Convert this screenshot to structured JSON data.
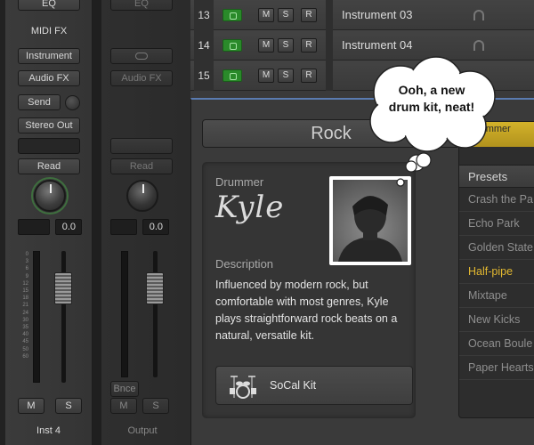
{
  "strip1": {
    "eq": "EQ",
    "midi_fx": "MIDI FX",
    "instrument": "Instrument",
    "audio_fx": "Audio FX",
    "send": "Send",
    "output": "Stereo Out",
    "automation": "Read",
    "volume": "0.0",
    "mute": "M",
    "solo": "S",
    "name": "Inst 4"
  },
  "strip2": {
    "eq": "EQ",
    "audio_fx": "Audio FX",
    "automation": "Read",
    "volume": "0.0",
    "bounce": "Bnce",
    "mute": "M",
    "solo": "S",
    "name": "Output"
  },
  "fader_scale": [
    "0",
    "3",
    "6",
    "9",
    "12",
    "15",
    "18",
    "21",
    "24",
    "30",
    "35",
    "40",
    "45",
    "50",
    "60"
  ],
  "tracks": [
    {
      "number": "13",
      "mute": "M",
      "solo": "S",
      "record": "R",
      "name": "Instrument 03"
    },
    {
      "number": "14",
      "mute": "M",
      "solo": "S",
      "record": "R",
      "name": "Instrument 04"
    },
    {
      "number": "15",
      "mute": "M",
      "solo": "S",
      "record": "R",
      "name": ""
    }
  ],
  "editor": {
    "style": "Rock",
    "drummer_label": "Drummer",
    "drummer_name": "Kyle",
    "description_label": "Description",
    "description": "Influenced by modern rock, but comfortable with most genres, Kyle plays straightforward rock beats on a natural, versatile kit.",
    "kit": "SoCal Kit",
    "tab": "Drummer",
    "presets_label": "Presets",
    "presets": [
      "Crash the Pa",
      "Echo Park",
      "Golden State",
      "Half-pipe",
      "Mixtape",
      "New Kicks",
      "Ocean Boule",
      "Paper Hearts"
    ],
    "selected_preset": "Half-pipe"
  },
  "bubble": {
    "text_line1": "Ooh, a new",
    "text_line2": "drum kit, neat!"
  },
  "colors": {
    "accent_yellow": "#e2b830",
    "track_icon_green": "#2a8a2a",
    "panel_border_blue": "#5a7bb0"
  }
}
